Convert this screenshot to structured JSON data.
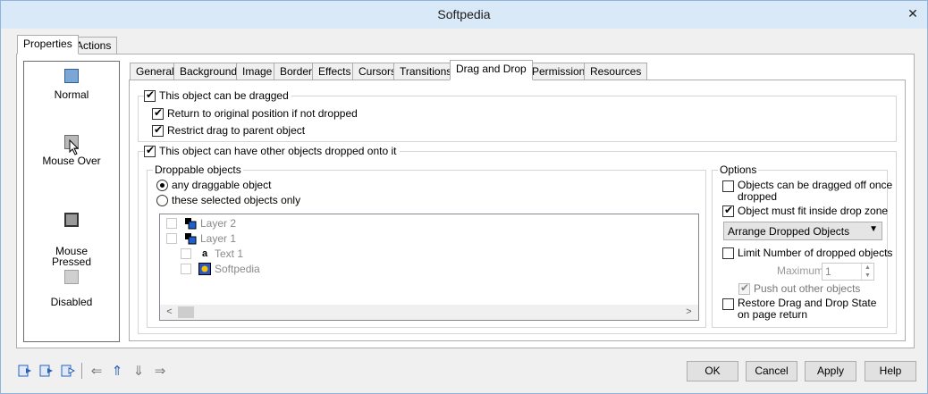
{
  "window": {
    "title": "Softpedia",
    "close_glyph": "✕"
  },
  "top_tabs": [
    {
      "label": "Properties",
      "active": true
    },
    {
      "label": "Actions",
      "active": false
    }
  ],
  "states": [
    {
      "label": "Normal",
      "icon": "normal-state-icon"
    },
    {
      "label": "Mouse Over",
      "icon": "mouse-over-state-icon"
    },
    {
      "label": "Mouse\nPressed",
      "icon": "mouse-pressed-state-icon"
    },
    {
      "label": "Disabled",
      "icon": "disabled-state-icon"
    }
  ],
  "tabs": [
    {
      "label": "General"
    },
    {
      "label": "Background"
    },
    {
      "label": "Image"
    },
    {
      "label": "Border"
    },
    {
      "label": "Effects"
    },
    {
      "label": "Cursors"
    },
    {
      "label": "Transitions"
    },
    {
      "label": "Drag and Drop",
      "active": true
    },
    {
      "label": "Permissions"
    },
    {
      "label": "Resources"
    }
  ],
  "drag": {
    "can_be_dragged": {
      "label": "This object can be dragged",
      "checked": true
    },
    "return_to_original": {
      "label": "Return to original position if not dropped",
      "checked": true
    },
    "restrict_to_parent": {
      "label": "Restrict drag to parent object",
      "checked": true
    },
    "can_have_dropped": {
      "label": "This object can have other objects dropped onto it",
      "checked": true
    }
  },
  "droppable": {
    "legend": "Droppable objects",
    "any_label": "any draggable object",
    "selected_label": "these selected objects only",
    "selected_option": "any",
    "items": [
      {
        "label": "Layer 2",
        "icon": "layer-icon"
      },
      {
        "label": "Layer 1",
        "icon": "layer-icon"
      },
      {
        "label": "Text 1",
        "icon": "text-icon",
        "glyph": "a"
      },
      {
        "label": "Softpedia",
        "icon": "image-icon"
      }
    ]
  },
  "options": {
    "legend": "Options",
    "dragged_off": {
      "label": "Objects can be dragged off once\ndropped",
      "checked": false
    },
    "must_fit": {
      "label": "Object must fit inside drop zone",
      "checked": true
    },
    "arrange_select": "Arrange Dropped Objects",
    "limit": {
      "label": "Limit Number of dropped objects",
      "checked": false
    },
    "maximum_label": "Maximum",
    "maximum_value": "1",
    "push_out": {
      "label": "Push out other objects",
      "checked": true,
      "disabled": true
    },
    "restore": {
      "label": "Restore Drag and Drop State\non page return",
      "checked": false
    }
  },
  "buttons": {
    "ok": "OK",
    "cancel": "Cancel",
    "apply": "Apply",
    "help": "Help"
  },
  "toolbar": {
    "icons": [
      "state-add-icon",
      "state-copy-icon",
      "state-edit-icon",
      "arrow-left-icon",
      "arrow-up-icon",
      "arrow-down-icon",
      "arrow-right-icon"
    ],
    "arrows": {
      "left": "⇐",
      "up": "⇑",
      "down": "⇓",
      "right": "⇒"
    }
  },
  "colors": {
    "title_bar": "#d9e9f8",
    "accent": "#2b62b5"
  }
}
